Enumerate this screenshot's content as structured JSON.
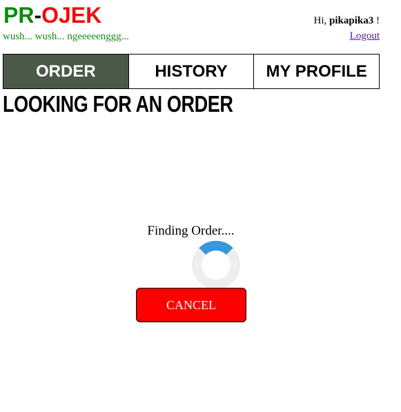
{
  "header": {
    "logo": {
      "part1": "PR",
      "dash": "-",
      "part2": "OJEK"
    },
    "tagline": "wush... wush... ngeeeeenggg...",
    "greeting_prefix": "Hi, ",
    "username": "pikapika3",
    "greeting_suffix": " !",
    "logout_label": "Logout"
  },
  "nav": {
    "tabs": [
      {
        "label": "ORDER",
        "active": true
      },
      {
        "label": "HISTORY",
        "active": false
      },
      {
        "label": "MY PROFILE",
        "active": false
      }
    ]
  },
  "main": {
    "page_title": "LOOKING FOR AN ORDER",
    "status_text": "Finding Order....",
    "loader_icon": "spinner-icon",
    "cancel_label": "CANCEL"
  },
  "colors": {
    "logo_green": "#0a8a0a",
    "logo_red": "#f20a0a",
    "tab_active_bg": "#4b5a48",
    "cancel_bg": "#ff0000",
    "spinner_track": "#eeeeee",
    "spinner_arc": "#3498db",
    "logout_link": "#551a8b"
  }
}
